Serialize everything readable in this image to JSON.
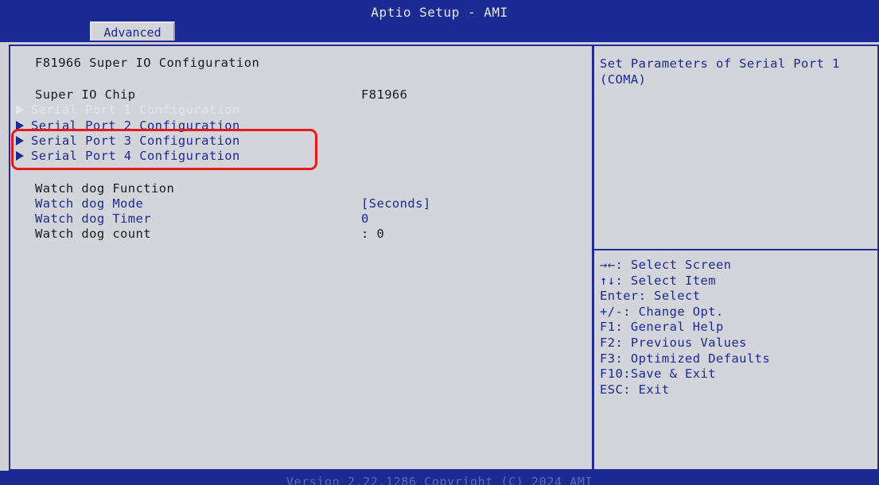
{
  "header": {
    "title": "Aptio Setup - AMI",
    "active_tab": "Advanced"
  },
  "main": {
    "section_title": "F81966 Super IO Configuration",
    "chip": {
      "label": "Super IO Chip",
      "value": "F81966"
    },
    "submenus": [
      {
        "label": "Serial Port 1 Configuration",
        "state": "selected"
      },
      {
        "label": "Serial Port 2 Configuration",
        "state": "normal"
      },
      {
        "label": "Serial Port 3 Configuration",
        "state": "normal"
      },
      {
        "label": "Serial Port 4 Configuration",
        "state": "normal"
      }
    ],
    "watchdog": {
      "function_label": "Watch dog Function",
      "mode_label": "Watch dog Mode",
      "mode_value": "[Seconds]",
      "timer_label": "Watch dog Timer",
      "timer_value": "0",
      "count_label": "Watch dog count",
      "count_value": ": 0"
    }
  },
  "help": {
    "description": "Set Parameters of Serial Port 1 (COMA)"
  },
  "keys": [
    "→←: Select Screen",
    "↑↓: Select Item",
    "Enter: Select",
    "+/-: Change Opt.",
    "F1: General Help",
    "F2: Previous Values",
    "F3: Optimized Defaults",
    "F10:Save & Exit",
    "ESC: Exit"
  ],
  "footer": {
    "text": "Version 2.22.1286 Copyright (C) 2024 AMI"
  },
  "colors": {
    "background": "#d4d5da",
    "accent_blue": "#1c2a93",
    "highlight_red": "#e21a1a"
  },
  "icons": {
    "submenu_arrow": "triangle-right-icon"
  }
}
